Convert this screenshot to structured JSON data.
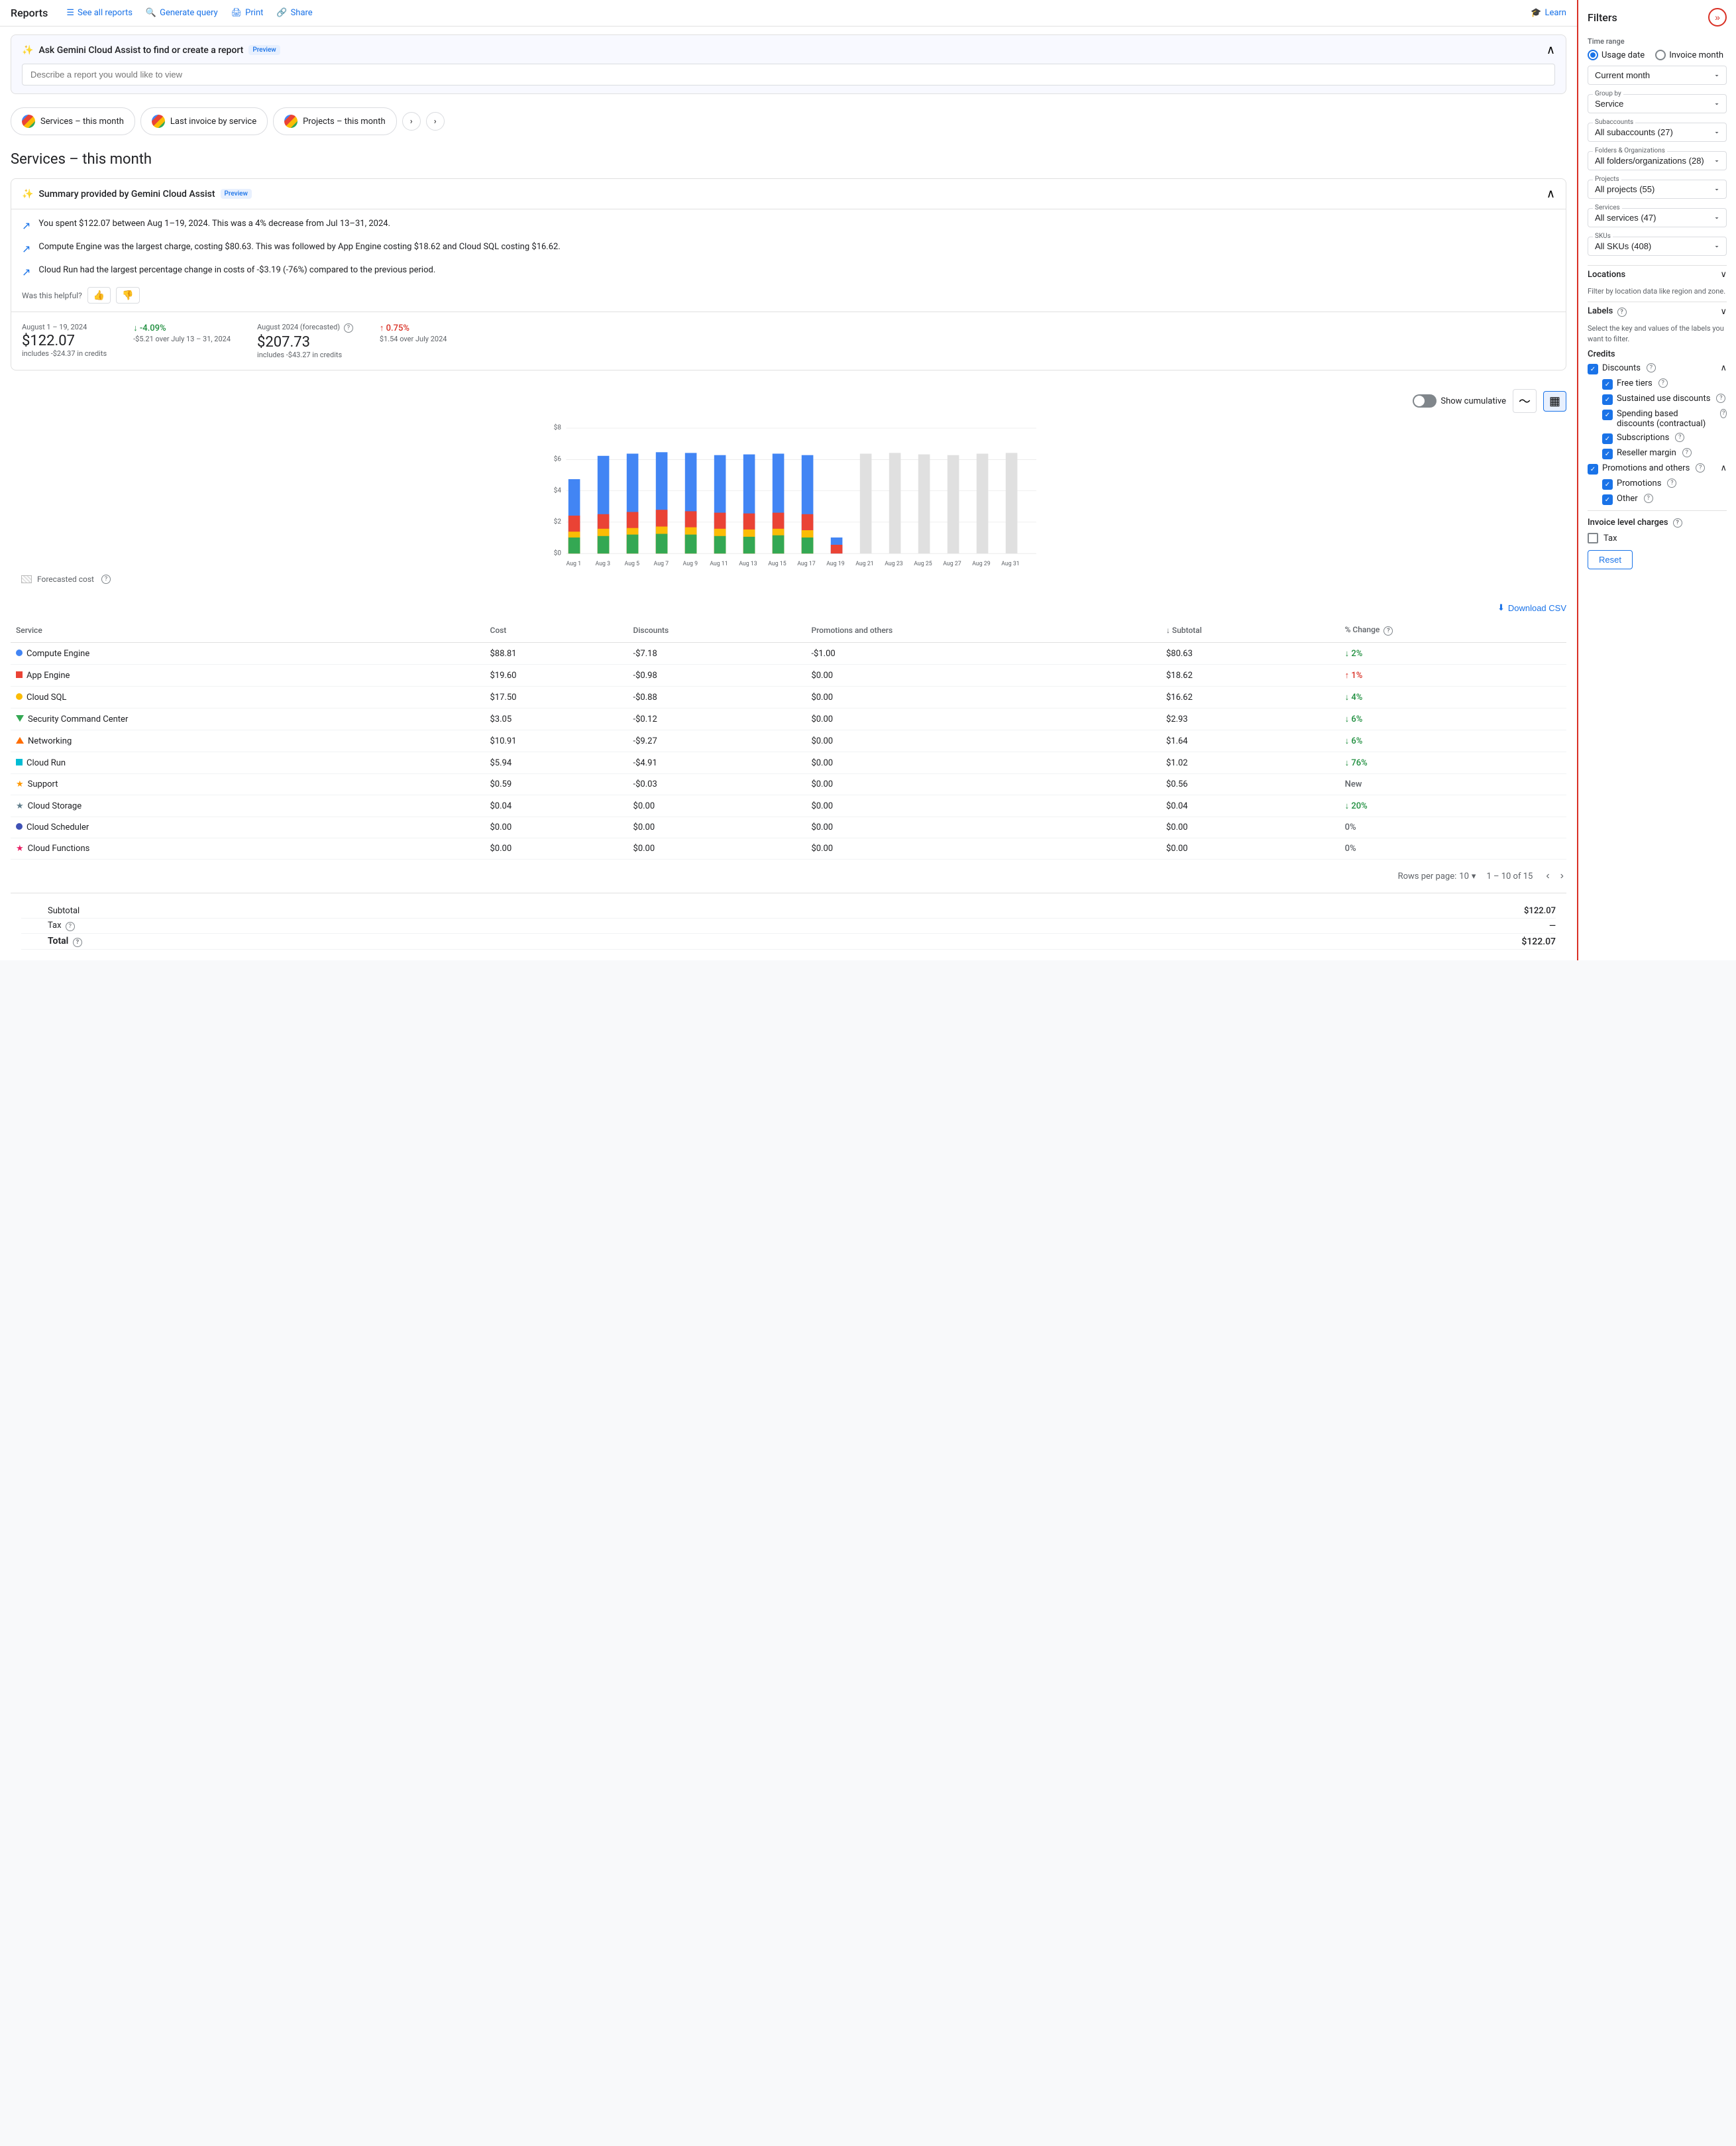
{
  "nav": {
    "brand": "Reports",
    "links": [
      {
        "id": "see-all",
        "icon": "☰",
        "label": "See all reports"
      },
      {
        "id": "generate",
        "icon": "🔍",
        "label": "Generate query"
      },
      {
        "id": "print",
        "icon": "🖨",
        "label": "Print"
      },
      {
        "id": "share",
        "icon": "🔗",
        "label": "Share"
      },
      {
        "id": "learn",
        "icon": "🎓",
        "label": "Learn"
      }
    ]
  },
  "gemini": {
    "title": "Ask Gemini Cloud Assist to find or create a report",
    "badge": "Preview",
    "placeholder": "Describe a report you would like to view"
  },
  "report_tabs": [
    {
      "label": "Services – this month"
    },
    {
      "label": "Last invoice by service"
    },
    {
      "label": "Projects – this month"
    }
  ],
  "page_title": "Services – this month",
  "summary": {
    "title": "Summary provided by Gemini Cloud Assist",
    "badge": "Preview",
    "rows": [
      "You spent $122.07 between Aug 1–19, 2024. This was a 4% decrease from Jul 13–31, 2024.",
      "Compute Engine was the largest charge, costing $80.63. This was followed by App Engine costing $18.62 and Cloud SQL costing $16.62.",
      "Cloud Run had the largest percentage change in costs of -$3.19 (-76%) compared to the previous period."
    ],
    "helpful_label": "Was this helpful?"
  },
  "stats": {
    "period1": {
      "label": "August 1 – 19, 2024",
      "value": "$122.07",
      "sub": "includes -$24.37 in credits",
      "change": "↓ -4.09%",
      "change_type": "down",
      "change_sub": "-$5.21 over July 13 – 31, 2024"
    },
    "period2": {
      "label": "August 2024 (forecasted)",
      "value": "$207.73",
      "sub": "includes -$43.27 in credits",
      "change": "↑ 0.75%",
      "change_type": "up",
      "change_sub": "$1.54 over July 2024"
    }
  },
  "chart": {
    "toggle_label": "Show cumulative",
    "y_labels": [
      "$8",
      "$6",
      "$4",
      "$2",
      "$0"
    ],
    "x_labels": [
      "Aug 1",
      "Aug 3",
      "Aug 5",
      "Aug 7",
      "Aug 9",
      "Aug 11",
      "Aug 13",
      "Aug 15",
      "Aug 17",
      "Aug 19",
      "Aug 21",
      "Aug 23",
      "Aug 25",
      "Aug 27",
      "Aug 29",
      "Aug 31"
    ],
    "forecasted_label": "Forecasted cost"
  },
  "table": {
    "download_label": "Download CSV",
    "headers": [
      "Service",
      "Cost",
      "Discounts",
      "Promotions and others",
      "↓ Subtotal",
      "% Change"
    ],
    "rows": [
      {
        "color": "#4285f4",
        "shape": "circle",
        "name": "Compute Engine",
        "cost": "$88.81",
        "discounts": "-$7.18",
        "promos": "-$1.00",
        "subtotal": "$80.63",
        "change": "↓ 2%",
        "change_type": "down"
      },
      {
        "color": "#ea4335",
        "shape": "square",
        "name": "App Engine",
        "cost": "$19.60",
        "discounts": "-$0.98",
        "promos": "$0.00",
        "subtotal": "$18.62",
        "change": "↑ 1%",
        "change_type": "up"
      },
      {
        "color": "#fbbc05",
        "shape": "circle",
        "name": "Cloud SQL",
        "cost": "$17.50",
        "discounts": "-$0.88",
        "promos": "$0.00",
        "subtotal": "$16.62",
        "change": "↓ 4%",
        "change_type": "down"
      },
      {
        "color": "#34a853",
        "shape": "triangle",
        "name": "Security Command Center",
        "cost": "$3.05",
        "discounts": "-$0.12",
        "promos": "$0.00",
        "subtotal": "$2.93",
        "change": "↓ 6%",
        "change_type": "down"
      },
      {
        "color": "#ff6d00",
        "shape": "triangle-up",
        "name": "Networking",
        "cost": "$10.91",
        "discounts": "-$9.27",
        "promos": "$0.00",
        "subtotal": "$1.64",
        "change": "↓ 6%",
        "change_type": "down"
      },
      {
        "color": "#00bcd4",
        "shape": "square",
        "name": "Cloud Run",
        "cost": "$5.94",
        "discounts": "-$4.91",
        "promos": "$0.00",
        "subtotal": "$1.02",
        "change": "↓ 76%",
        "change_type": "down"
      },
      {
        "color": "#ff9800",
        "shape": "star",
        "name": "Support",
        "cost": "$0.59",
        "discounts": "-$0.03",
        "promos": "$0.00",
        "subtotal": "$0.56",
        "change": "New",
        "change_type": "neutral"
      },
      {
        "color": "#607d8b",
        "shape": "star",
        "name": "Cloud Storage",
        "cost": "$0.04",
        "discounts": "$0.00",
        "promos": "$0.00",
        "subtotal": "$0.04",
        "change": "↓ 20%",
        "change_type": "down"
      },
      {
        "color": "#3f51b5",
        "shape": "circle",
        "name": "Cloud Scheduler",
        "cost": "$0.00",
        "discounts": "$0.00",
        "promos": "$0.00",
        "subtotal": "$0.00",
        "change": "0%",
        "change_type": "neutral"
      },
      {
        "color": "#e91e63",
        "shape": "star",
        "name": "Cloud Functions",
        "cost": "$0.00",
        "discounts": "$0.00",
        "promos": "$0.00",
        "subtotal": "$0.00",
        "change": "0%",
        "change_type": "neutral"
      }
    ],
    "pagination": {
      "rows_per_page": "10",
      "range": "1 – 10 of 15"
    }
  },
  "totals": {
    "subtotal_label": "Subtotal",
    "subtotal_value": "$122.07",
    "tax_label": "Tax",
    "tax_value": "—",
    "total_label": "Total",
    "total_value": "$122.07"
  },
  "filters": {
    "title": "Filters",
    "time_range_label": "Time range",
    "usage_date_label": "Usage date",
    "invoice_month_label": "Invoice month",
    "current_month_label": "Current month",
    "group_by_label": "Group by",
    "group_by_value": "Service",
    "subaccounts_label": "Subaccounts",
    "subaccounts_value": "All subaccounts (27)",
    "folders_label": "Folders & Organizations",
    "folders_value": "All folders/organizations (28)",
    "projects_label": "Projects",
    "projects_value": "All projects (55)",
    "services_label": "Services",
    "services_value": "All services (47)",
    "skus_label": "SKUs",
    "skus_value": "All SKUs (408)",
    "locations_label": "Locations",
    "locations_sub": "Filter by location data like region and zone.",
    "labels_label": "Labels",
    "labels_sub": "Select the key and values of the labels you want to filter.",
    "credits_label": "Credits",
    "discounts_label": "Discounts",
    "free_tiers_label": "Free tiers",
    "sustained_label": "Sustained use discounts",
    "spending_label": "Spending based discounts (contractual)",
    "subscriptions_label": "Subscriptions",
    "reseller_label": "Reseller margin",
    "promos_others_label": "Promotions and others",
    "promotions_label": "Promotions",
    "other_label": "Other",
    "invoice_charges_label": "Invoice level charges",
    "tax_label": "Tax",
    "reset_label": "Reset"
  }
}
